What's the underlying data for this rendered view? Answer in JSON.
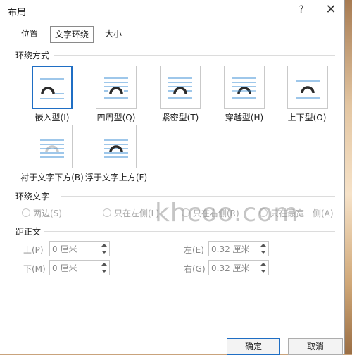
{
  "window": {
    "title": "布局",
    "help_label": "?",
    "close_label": "✕"
  },
  "tabs": [
    {
      "label": "位置",
      "active": false
    },
    {
      "label": "文字环绕",
      "active": true
    },
    {
      "label": "大小",
      "active": false
    }
  ],
  "wrap_style": {
    "section_title": "环绕方式",
    "options": [
      {
        "label": "嵌入型(I)",
        "icon": "inline-wrap-icon",
        "selected": true
      },
      {
        "label": "四周型(Q)",
        "icon": "square-wrap-icon",
        "selected": false
      },
      {
        "label": "紧密型(T)",
        "icon": "tight-wrap-icon",
        "selected": false
      },
      {
        "label": "穿越型(H)",
        "icon": "through-wrap-icon",
        "selected": false
      },
      {
        "label": "上下型(O)",
        "icon": "top-bottom-wrap-icon",
        "selected": false
      },
      {
        "label": "衬于文字下方(B)",
        "icon": "behind-text-icon",
        "selected": false
      },
      {
        "label": "浮于文字上方(F)",
        "icon": "in-front-text-icon",
        "selected": false
      }
    ]
  },
  "wrap_text": {
    "section_title": "环绕文字",
    "options": [
      {
        "label": "两边(S)",
        "enabled": false
      },
      {
        "label": "只在左侧(L)",
        "enabled": false
      },
      {
        "label": "只在右侧(R)",
        "enabled": false
      },
      {
        "label": "只在最宽一侧(A)",
        "enabled": false
      }
    ]
  },
  "distance": {
    "section_title": "距正文",
    "top": {
      "label": "上(P)",
      "value": "0 厘米"
    },
    "bottom": {
      "label": "下(M)",
      "value": "0 厘米"
    },
    "left": {
      "label": "左(E)",
      "value": "0.32 厘米"
    },
    "right": {
      "label": "右(G)",
      "value": "0.32 厘米"
    }
  },
  "watermark": "khcoo.com",
  "buttons": {
    "ok": "确定",
    "cancel": "取消"
  },
  "colors": {
    "accent": "#1f6ec4",
    "wrap_line": "#3c8fd6",
    "icon_dark": "#2b2b2b"
  }
}
